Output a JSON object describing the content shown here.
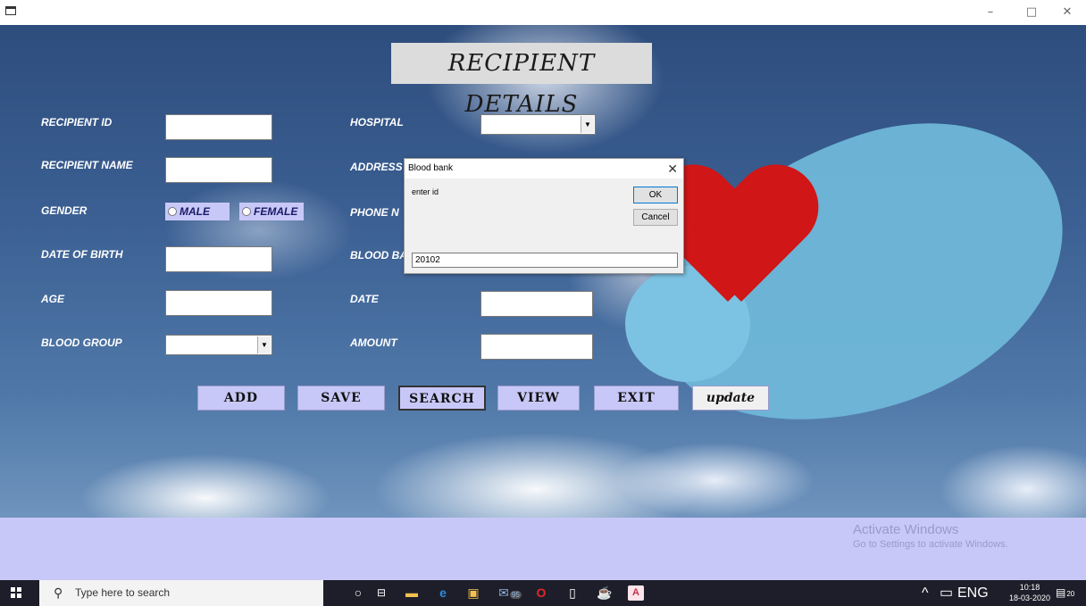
{
  "window": {
    "minimize": "–",
    "maximize": "□",
    "close": "✕"
  },
  "form": {
    "title": "RECIPIENT DETAILS",
    "labels": {
      "recipient_id": "RECIPIENT ID",
      "recipient_name": "RECIPIENT NAME",
      "gender": "GENDER",
      "date_of_birth": "DATE OF BIRTH",
      "age": "AGE",
      "blood_group": "BLOOD GROUP",
      "hospital": "HOSPITAL",
      "address": "ADDRESS",
      "phone": "PHONE N",
      "blood_bank": "BLOOD BA",
      "date": "DATE",
      "amount": "AMOUNT"
    },
    "gender_options": [
      "MALE",
      "FEMALE"
    ],
    "buttons": {
      "add": "ADD",
      "save": "SAVE",
      "search": "SEARCH",
      "view": "VIEW",
      "exit": "EXIT",
      "update": "update"
    }
  },
  "dialog": {
    "title": "Blood bank",
    "close": "✕",
    "prompt": "enter id",
    "ok": "OK",
    "cancel": "Cancel",
    "input_value": "20102"
  },
  "watermark": {
    "line1": "Activate Windows",
    "line2": "Go to Settings to activate Windows."
  },
  "taskbar": {
    "search_placeholder": "Type here to search",
    "mail_badge": "95",
    "language": "ENG",
    "time": "10:18",
    "date": "18-03-2020",
    "notifications": "20",
    "icons": [
      "cortana-icon",
      "task-view-icon",
      "file-explorer-icon",
      "edge-icon",
      "store-icon",
      "mail-icon",
      "opera-icon",
      "notepad-icon",
      "java-icon",
      "access-icon"
    ]
  },
  "colors": {
    "accent_lavender": "#c8c8f8",
    "taskbar": "#1e1e2a",
    "heart_red": "#d01616",
    "glove_blue": "#6fb7d9"
  }
}
